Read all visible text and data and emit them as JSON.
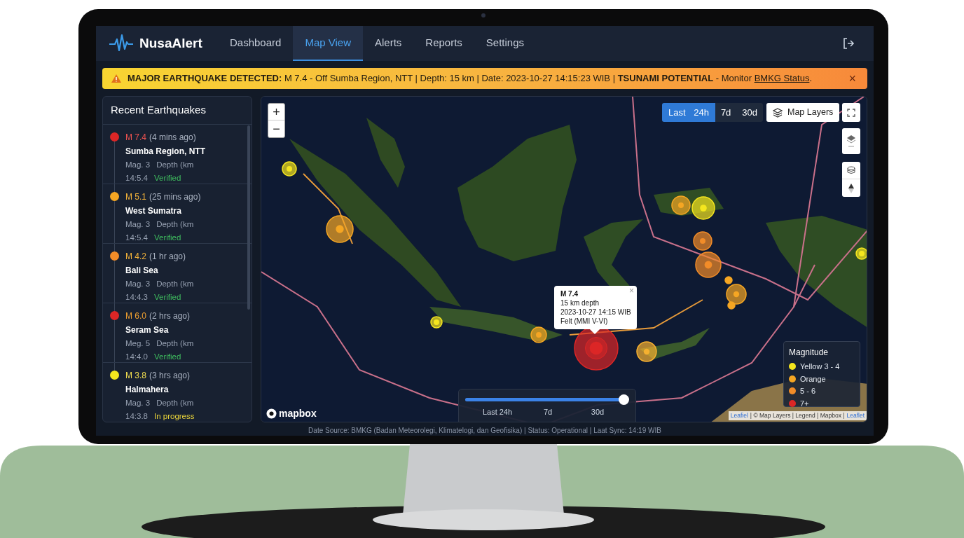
{
  "nav": {
    "logo": "NusaAlert",
    "tabs": [
      {
        "label": "Dashboard",
        "selected": false
      },
      {
        "label": "Map View",
        "selected": true
      },
      {
        "label": "Alerts",
        "selected": false
      },
      {
        "label": "Reports",
        "selected": false
      },
      {
        "label": "Settings",
        "selected": false
      }
    ]
  },
  "alert": {
    "text": "**MAJOR EARTHQUAKE DETECTED:** M 7.4 - Off Sumba Region, NTT | Depth: 15 km | Date: 2023-10-27 14:15:23 WIB | **TSUNAMI POTENTIAL** - Monitor ",
    "link": "BMKG Status",
    "after": ".",
    "close": "×"
  },
  "sidebar": {
    "title": "Recent Earthquakes",
    "items": [
      {
        "color": "#dc2626",
        "magnitude": {
          "text": "M 7.4",
          "color": "#ef5350"
        },
        "ago": "(4 mins ago)",
        "place": "Sumba Region, NTT",
        "mag": "Mag. 3",
        "depth": "Depth (km",
        "time": "14:5.4",
        "status": {
          "text": "Verified",
          "kind": "verified"
        }
      },
      {
        "color": "#f5a623",
        "magnitude": {
          "text": "M 5.1",
          "color": "#f5b43a"
        },
        "ago": "(25 mins ago)",
        "place": "West Sumatra",
        "mag": "Mag. 3",
        "depth": "Depth (km",
        "time": "14:5.4",
        "status": {
          "text": "Verified",
          "kind": "verified"
        }
      },
      {
        "color": "#f28c28",
        "magnitude": {
          "text": "M 4.2",
          "color": "#f5b43a"
        },
        "ago": "(1 hr ago)",
        "place": "Bali Sea",
        "mag": "Mag. 3",
        "depth": "Depth (km",
        "time": "14:4.3",
        "status": {
          "text": "Verified",
          "kind": "verified"
        }
      },
      {
        "color": "#dc2626",
        "magnitude": {
          "text": "M 6.0",
          "color": "#f0a030"
        },
        "ago": "(2 hrs ago)",
        "place": "Seram Sea",
        "mag": "Meg. 5",
        "depth": "Depth (km",
        "time": "14:4.0",
        "status": {
          "text": "Verified",
          "kind": "verified"
        }
      },
      {
        "color": "#f5e61e",
        "magnitude": {
          "text": "M 3.8",
          "color": "#f5e050"
        },
        "ago": "(3 hrs ago)",
        "place": "Halmahera",
        "mag": "Mag. 3",
        "depth": "Depth (km",
        "time": "14:3.8",
        "status": {
          "text": "In progress",
          "kind": "in_progress"
        }
      }
    ]
  },
  "map": {
    "zoom_in": "+",
    "zoom_out": "−",
    "ranges": [
      {
        "label": "Last 24h",
        "selected": true
      },
      {
        "label": "7d",
        "selected": false
      },
      {
        "label": "30d",
        "selected": false
      }
    ],
    "layers_button": "Map Layers",
    "markers": [
      {
        "color": "#f5e61e"
      },
      {
        "color": "#f5a623"
      },
      {
        "color": "#f5e61e"
      },
      {
        "color": "#f5a623"
      },
      {
        "color": "#dc2626"
      },
      {
        "color": "#f5b030"
      },
      {
        "color": "#f5a623"
      },
      {
        "color": "#f5e61e"
      },
      {
        "color": "#f28c28"
      },
      {
        "color": "#f28c28"
      },
      {
        "color": "#f5a623"
      },
      {
        "color": "#f5a623"
      },
      {
        "color": "#f5a623"
      },
      {
        "color": "#f5e61e"
      }
    ],
    "popup": {
      "title": "M 7.4",
      "lines": [
        "15 km depth",
        "2023-10-27 14:15 WIB",
        "Felt (MMI V-VI)"
      ],
      "close": "×"
    },
    "slider": {
      "level": 1,
      "ticks": [
        "Last 24h",
        "7d",
        "30d"
      ]
    },
    "legend": {
      "title": "Magnitude",
      "items": [
        {
          "label": "Yellow 3 - 4",
          "color": "#f5e61e"
        },
        {
          "label": "Orange",
          "color": "#f5a623"
        },
        {
          "label": "5 - 6",
          "color": "#f28c28"
        },
        {
          "label": "7+",
          "color": "#dc2626"
        }
      ]
    },
    "logo": "mapbox",
    "attribution": [
      {
        "text": "Leafiel",
        "kind": "link"
      },
      {
        "text": "| © Map Layers | Legend | Mapbox |",
        "kind": "plain"
      },
      {
        "text": "Leaflet",
        "kind": "link"
      }
    ]
  },
  "footer": "Date Source: BMKG (Badan Meteorolegi, Klimatelogi, dan Geofisika) | Status: Operational | Laat Sync: 14:19 WIB"
}
